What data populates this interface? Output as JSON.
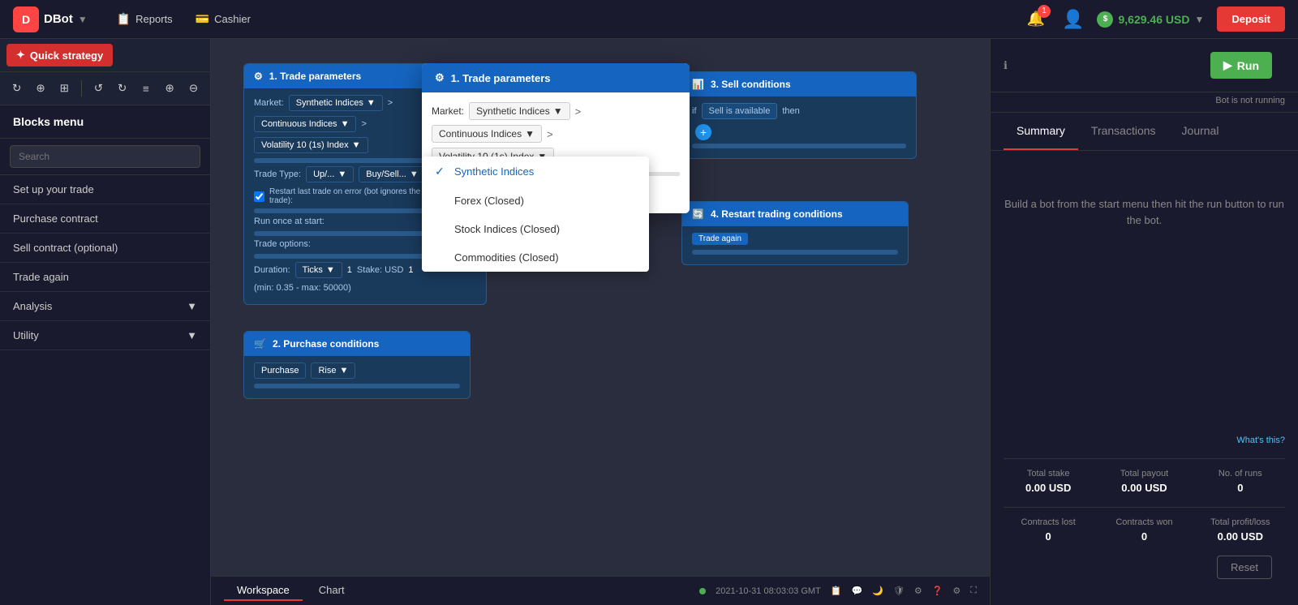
{
  "navbar": {
    "logo": "D",
    "app_name": "DBot",
    "reports_label": "Reports",
    "cashier_label": "Cashier",
    "notification_count": "1",
    "balance": "9,629.46 USD",
    "deposit_label": "Deposit"
  },
  "toolbar": {
    "quick_strategy_label": "Quick strategy"
  },
  "sidebar": {
    "title": "Blocks menu",
    "search_placeholder": "Search",
    "items": [
      {
        "label": "Set up your trade",
        "id": "setup"
      },
      {
        "label": "Purchase contract",
        "id": "purchase"
      },
      {
        "label": "Sell contract (optional)",
        "id": "sell"
      },
      {
        "label": "Trade again",
        "id": "trade-again"
      },
      {
        "label": "Analysis",
        "id": "analysis",
        "has_arrow": true
      },
      {
        "label": "Utility",
        "id": "utility",
        "has_arrow": true
      }
    ]
  },
  "trade_params_modal": {
    "title": "1. Trade parameters",
    "market_label": "Market:",
    "market_value": "Synthetic Indices",
    "arrow_label": ">",
    "continuous_label": "Continuous Indices",
    "volatility_label": "Volatility 10 (1s) Index"
  },
  "market_dropdown": {
    "items": [
      {
        "label": "Synthetic Indices",
        "selected": true
      },
      {
        "label": "Forex (Closed)",
        "selected": false
      },
      {
        "label": "Stock Indices (Closed)",
        "selected": false
      },
      {
        "label": "Commodities (Closed)",
        "selected": false
      }
    ]
  },
  "blocks": {
    "block1": {
      "title": "1. Trade parameters",
      "market_label": "Market:",
      "market_value": "Synthetic Indices",
      "continuous_value": "Continuous Indices",
      "volatility_value": "Volatility 10 (1s) Index",
      "trade_type_label": "Trade Type:",
      "buysell_label": "Buy/Sell...",
      "restart_checkbox": "Restart last trade on error (bot ignores the unsuccessful trade):",
      "run_once_label": "Run once at start:",
      "trade_options_label": "Trade options:",
      "duration_label": "Duration:",
      "ticks_label": "Ticks",
      "tick_value": "1",
      "stake_label": "Stake: USD",
      "stake_value": "1",
      "min_max_label": "(min: 0.35 - max: 50000)"
    },
    "block2": {
      "title": "2. Purchase conditions",
      "purchase_label": "Purchase",
      "rise_label": "Rise"
    },
    "block3": {
      "title": "3. Sell conditions",
      "sell_label": "Sell is available",
      "then_label": "then"
    },
    "block4": {
      "title": "4. Restart trading conditions",
      "trade_again_label": "Trade again"
    }
  },
  "right_panel": {
    "info_icon": "ℹ",
    "run_label": "Run",
    "bot_status": "Bot is not running",
    "tabs": [
      {
        "label": "Summary",
        "active": true
      },
      {
        "label": "Transactions",
        "active": false
      },
      {
        "label": "Journal",
        "active": false
      }
    ],
    "summary_message": "Build a bot from the start menu then hit the run button to run the bot.",
    "whats_this": "What's this?",
    "stats": {
      "total_stake_label": "Total stake",
      "total_stake_value": "0.00 USD",
      "total_payout_label": "Total payout",
      "total_payout_value": "0.00 USD",
      "no_of_runs_label": "No. of runs",
      "no_of_runs_value": "0",
      "contracts_lost_label": "Contracts lost",
      "contracts_lost_value": "0",
      "contracts_won_label": "Contracts won",
      "contracts_won_value": "0",
      "total_profit_label": "Total profit/loss",
      "total_profit_value": "0.00 USD"
    },
    "reset_label": "Reset"
  },
  "bottom_bar": {
    "workspace_tab": "Workspace",
    "chart_tab": "Chart",
    "status_dot_color": "#4caf50",
    "timestamp": "2021-10-31 08:03:03 GMT"
  }
}
